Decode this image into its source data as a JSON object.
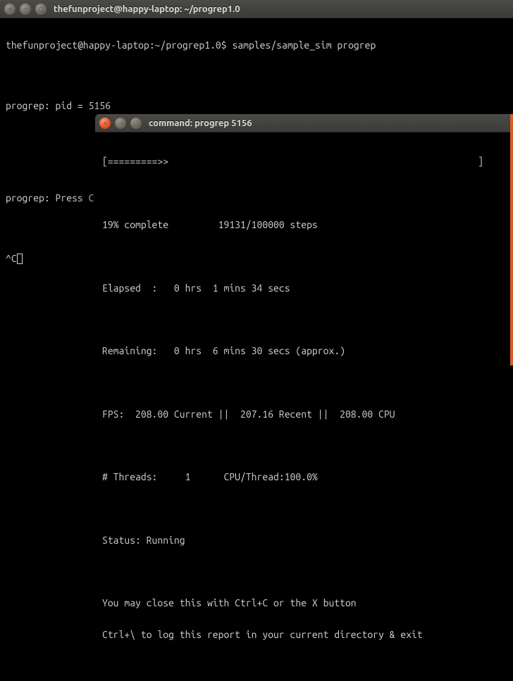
{
  "main_window": {
    "title": "thefunproject@happy-laptop: ~/progrep1.0",
    "prompt": "thefunproject@happy-laptop:~/progrep1.0$ samples/sample_sim progrep",
    "line_pid": "progrep: pid = 5156",
    "line_help": "progrep: Press Ctrl+C to query progress, and, Ctrl+\\ to pause or quit",
    "ctrlc": "^C"
  },
  "sub_window": {
    "title": "command: progrep 5156",
    "bar": "[=========>>                                                        ]",
    "pct_line": "19% complete         19131/100000 steps",
    "elapsed": "Elapsed  :   0 hrs  1 mins 34 secs",
    "remaining": "Remaining:   0 hrs  6 mins 30 secs (approx.)",
    "fps": "FPS:  208.00 Current ||  207.16 Recent ||  208.00 CPU",
    "threads": "# Threads:     1      CPU/Thread:100.0%",
    "status": "Status: Running",
    "footer1": "You may close this with Ctrl+C or the X button",
    "footer2": "Ctrl+\\ to log this report in your current directory & exit"
  },
  "icons": {
    "close": "×",
    "min": "–",
    "max": "▢"
  }
}
